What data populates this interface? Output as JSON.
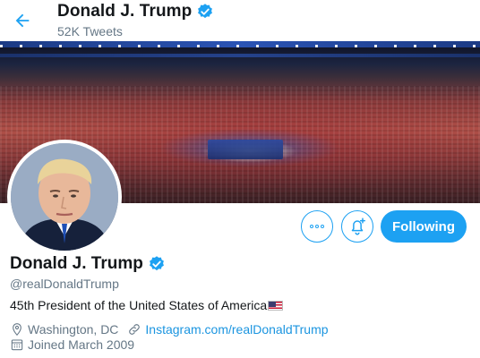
{
  "header": {
    "name": "Donald J. Trump",
    "tweet_count": "52K Tweets"
  },
  "profile": {
    "name": "Donald J. Trump",
    "handle": "@realDonaldTrump",
    "bio": "45th President of the United States of America",
    "location": "Washington, DC",
    "website": "Instagram.com/realDonaldTrump",
    "joined": "Joined March 2009",
    "verified": true
  },
  "actions": {
    "follow_label": "Following"
  },
  "icons": {
    "back": "arrow-left-icon",
    "verified": "verified-badge-icon",
    "more": "more-dots-icon",
    "notifications": "bell-plus-icon",
    "location": "location-pin-icon",
    "link": "link-icon",
    "calendar": "calendar-icon",
    "flag": "us-flag-emoji"
  },
  "colors": {
    "accent": "#1da1f2",
    "link": "#1b95e0",
    "muted": "#657786",
    "text": "#14171a"
  }
}
